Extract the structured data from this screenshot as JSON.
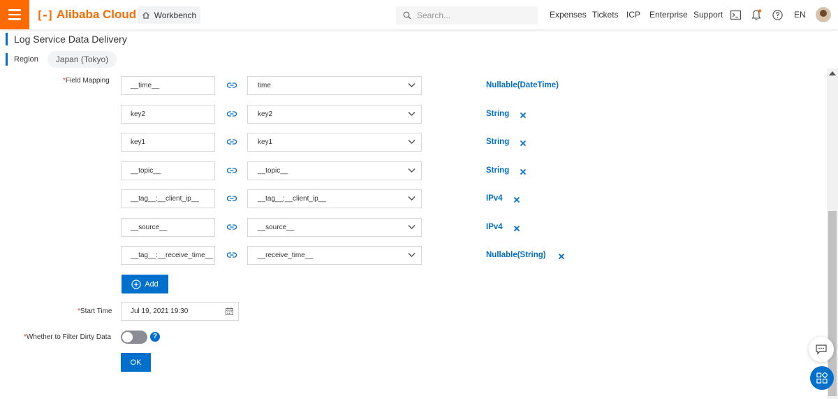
{
  "topbar": {
    "logo_mark": "[-]",
    "logo_text": "Alibaba Cloud",
    "workbench_label": "Workbench",
    "search_placeholder": "Search...",
    "nav": [
      "Expenses",
      "Tickets",
      "ICP",
      "Enterprise",
      "Support"
    ],
    "lang": "EN",
    "icons": [
      "menu-icon",
      "home-icon",
      "search-icon",
      "terminal-icon",
      "bell-icon",
      "help-icon",
      "avatar"
    ],
    "colors": {
      "brand": "#ff6a00",
      "accent": "#0070cc"
    }
  },
  "page": {
    "title": "Log Service Data Delivery",
    "region_label": "Region",
    "region_value": "Japan (Tokyo)"
  },
  "form": {
    "field_mapping_label": "Field Mapping",
    "mappings": [
      {
        "source": "__time__",
        "target": "time",
        "type": "Nullable(DateTime)",
        "removable": false
      },
      {
        "source": "key2",
        "target": "key2",
        "type": "String",
        "removable": true
      },
      {
        "source": "key1",
        "target": "key1",
        "type": "String",
        "removable": true
      },
      {
        "source": "__topic__",
        "target": "__topic__",
        "type": "String",
        "removable": true
      },
      {
        "source": "__tag__:__client_ip__",
        "target": "__tag__:__client_ip__",
        "type": "IPv4",
        "removable": true
      },
      {
        "source": "__source__",
        "target": "__source__",
        "type": "IPv4",
        "removable": true
      },
      {
        "source": "__tag__:__receive_time__",
        "target": "__receive_time__",
        "type": "Nullable(String)",
        "removable": true
      }
    ],
    "add_label": "Add",
    "start_time_label": "Start Time",
    "start_time_value": "Jul 19, 2021 19:30",
    "filter_dirty_label": "Whether to Filter Dirty Data",
    "filter_dirty_enabled": false,
    "help_glyph": "?",
    "ok_label": "OK",
    "required_mark": "*"
  }
}
